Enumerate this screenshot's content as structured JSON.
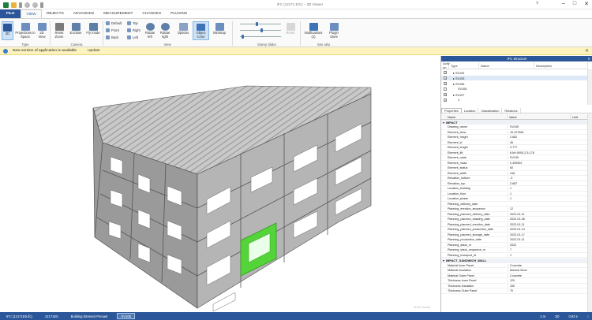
{
  "titlebar": {
    "title": "IFC (12171 E/C) – 3D Viewer",
    "help": "?",
    "minimize": "–",
    "restore": "□",
    "close": "✕"
  },
  "tabs": [
    "FILE",
    "VIEW",
    "OBJECTS",
    "ADVANCED",
    "MEASUREMENT",
    "CHANGES",
    "PLUGINS"
  ],
  "ribbon": {
    "type": {
      "btn_3d": "3D",
      "btn_proj": "Projections in Space",
      "btn_2d": "2D View",
      "label": "Type"
    },
    "camera": {
      "reset": "Reset Zoom",
      "enclose": "Enclose",
      "fly": "Fly mode",
      "label": "Camera"
    },
    "view_small": [
      "Default",
      "Front",
      "Back",
      "Top",
      "Right",
      "Left"
    ],
    "view": {
      "rot_left": "Rotate left",
      "rot_right": "Rotate right",
      "options": "Options",
      "object_color": "Object Color",
      "minimap": "Minimap",
      "label": "View"
    },
    "storey": {
      "label": "Storey Slider",
      "reset": "Reset"
    },
    "see_also": {
      "notifications": "Notifications (1)",
      "plugin_store": "Plugin Store",
      "label": "See also"
    }
  },
  "notification": {
    "text": "New version of application is available",
    "action": "Update",
    "close": "✕"
  },
  "viewport": {
    "watermark": "3DM Viewer"
  },
  "panel": {
    "title": "IFC Structure",
    "columns": [
      "Activ on",
      "Type",
      "Name",
      "Description"
    ],
    "rows": [
      {
        "type": "▸ SV104",
        "checked": true
      },
      {
        "type": "▸ SV105",
        "checked": true,
        "selected": true
      },
      {
        "type": "▸ SV106",
        "checked": true
      },
      {
        "type": "SV106",
        "checked": false
      },
      {
        "type": "▸ SV107",
        "checked": true
      },
      {
        "type": "1",
        "checked": true
      }
    ],
    "subtabs": [
      "Properties",
      "Location",
      "Classification",
      "Relations"
    ],
    "prop_columns": [
      "Name",
      "Value",
      "Unit"
    ],
    "group1": "IMPACT",
    "props": [
      [
        "Drawing_name",
        "SV105"
      ],
      [
        "Element_area",
        "10,107584"
      ],
      [
        "Element_height",
        "2.662"
      ],
      [
        "Element_id",
        "46"
      ],
      [
        "Element_length",
        "3.777"
      ],
      [
        "Element_lift",
        "KAH-9000-2,5-178"
      ],
      [
        "Element_mark",
        "SV105"
      ],
      [
        "Element_mass",
        "2,493902"
      ],
      [
        "Element_status",
        "60"
      ],
      [
        "Element_width",
        "248"
      ],
      [
        "Elevation_bottom",
        "-3"
      ],
      [
        "Elevation_top",
        "2.687"
      ],
      [
        "Location_building",
        "1"
      ],
      [
        "Location_floor",
        "1"
      ],
      [
        "Location_phase",
        "1"
      ],
      [
        "Planning_delivery_date",
        ""
      ],
      [
        "Planning_erection_sequence",
        "12"
      ],
      [
        "Planning_planned_delivery_date",
        "2022-01-11"
      ],
      [
        "Planning_planned_drawing_date",
        "2022-01-06"
      ],
      [
        "Planning_planned_erection_date",
        "2022-01-11"
      ],
      [
        "Planning_planned_production_date",
        "2022-01-13"
      ],
      [
        "Planning_planned_storage_date",
        "2022-01-17"
      ],
      [
        "Planning_production_date",
        "2022-01-11"
      ],
      [
        "Planning_stack_nr",
        "2022"
      ],
      [
        "Planning_stack_sequence_nr",
        "7"
      ],
      [
        "Planning_transport_id",
        "1"
      ]
    ],
    "group2": "IMPACT_SANDWICH_WALL",
    "props2": [
      [
        "Material Inner Panel",
        "Concrete"
      ],
      [
        "Material Insulation",
        "Mineral Wool"
      ],
      [
        "Material Outer Panel",
        "Concrete"
      ],
      [
        "Thickness Inner Panel",
        "120"
      ],
      [
        "Thickness Insulation",
        "150"
      ],
      [
        "Thickness Outer Panel",
        "70"
      ]
    ]
  },
  "status": {
    "items": [
      "IFC (12171E5.ifc)",
      "12171E5",
      "Building Element Precast"
    ],
    "active": "SV105",
    "right": [
      "1 m",
      "3D",
      "0.83 s",
      "↕"
    ]
  },
  "colors": {
    "accent": "#2b579a",
    "highlight_panel": "#55d43a"
  }
}
